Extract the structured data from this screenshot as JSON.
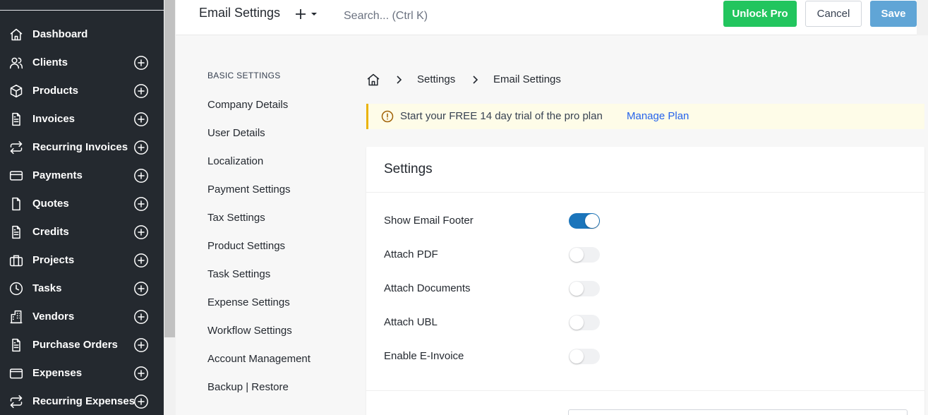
{
  "sidebar": {
    "items": [
      {
        "label": "Dashboard",
        "icon": "home-icon",
        "add": false
      },
      {
        "label": "Clients",
        "icon": "users-icon",
        "add": true
      },
      {
        "label": "Products",
        "icon": "box-icon",
        "add": true
      },
      {
        "label": "Invoices",
        "icon": "file-text-icon",
        "add": true
      },
      {
        "label": "Recurring Invoices",
        "icon": "repeat-icon",
        "add": true
      },
      {
        "label": "Payments",
        "icon": "credit-card-icon",
        "add": true
      },
      {
        "label": "Quotes",
        "icon": "file-icon",
        "add": true
      },
      {
        "label": "Credits",
        "icon": "file-text-icon",
        "add": true
      },
      {
        "label": "Projects",
        "icon": "briefcase-icon",
        "add": true
      },
      {
        "label": "Tasks",
        "icon": "clock-icon",
        "add": true
      },
      {
        "label": "Vendors",
        "icon": "building-icon",
        "add": true
      },
      {
        "label": "Purchase Orders",
        "icon": "file-text-icon",
        "add": true
      },
      {
        "label": "Expenses",
        "icon": "wallet-icon",
        "add": true
      },
      {
        "label": "Recurring Expenses",
        "icon": "repeat-icon",
        "add": true
      }
    ]
  },
  "header": {
    "title": "Email Settings",
    "search_placeholder": "Search... (Ctrl K)",
    "unlock_label": "Unlock Pro",
    "cancel_label": "Cancel",
    "save_label": "Save"
  },
  "settings_nav": {
    "heading": "BASIC SETTINGS",
    "links": [
      "Company Details",
      "User Details",
      "Localization",
      "Payment Settings",
      "Tax Settings",
      "Product Settings",
      "Task Settings",
      "Expense Settings",
      "Workflow Settings",
      "Account Management",
      "Backup | Restore"
    ]
  },
  "breadcrumb": {
    "items": [
      "Settings",
      "Email Settings"
    ]
  },
  "banner": {
    "text": "Start your FREE 14 day trial of the pro plan",
    "link": "Manage Plan"
  },
  "card": {
    "title": "Settings",
    "rows": [
      {
        "label": "Show Email Footer",
        "on": true
      },
      {
        "label": "Attach PDF",
        "on": false
      },
      {
        "label": "Attach Documents",
        "on": false
      },
      {
        "label": "Attach UBL",
        "on": false
      },
      {
        "label": "Enable E-Invoice",
        "on": false
      }
    ]
  },
  "colors": {
    "sidebar_bg": "#24292f",
    "accent_green": "#22c55e",
    "save_blue": "#60a5d6",
    "toggle_on": "#1b75bb",
    "banner_bg": "#fefce8",
    "banner_border": "#eab308",
    "link_blue": "#2563eb"
  }
}
